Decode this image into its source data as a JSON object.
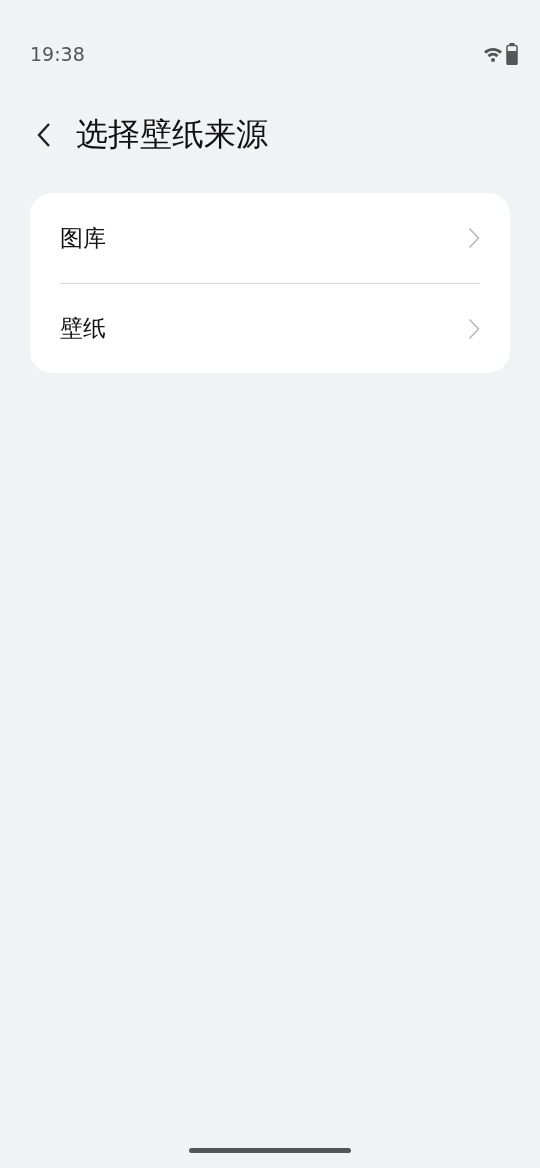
{
  "status_bar": {
    "time": "19:38"
  },
  "header": {
    "title": "选择壁纸来源"
  },
  "items": [
    {
      "label": "图库"
    },
    {
      "label": "壁纸"
    }
  ]
}
